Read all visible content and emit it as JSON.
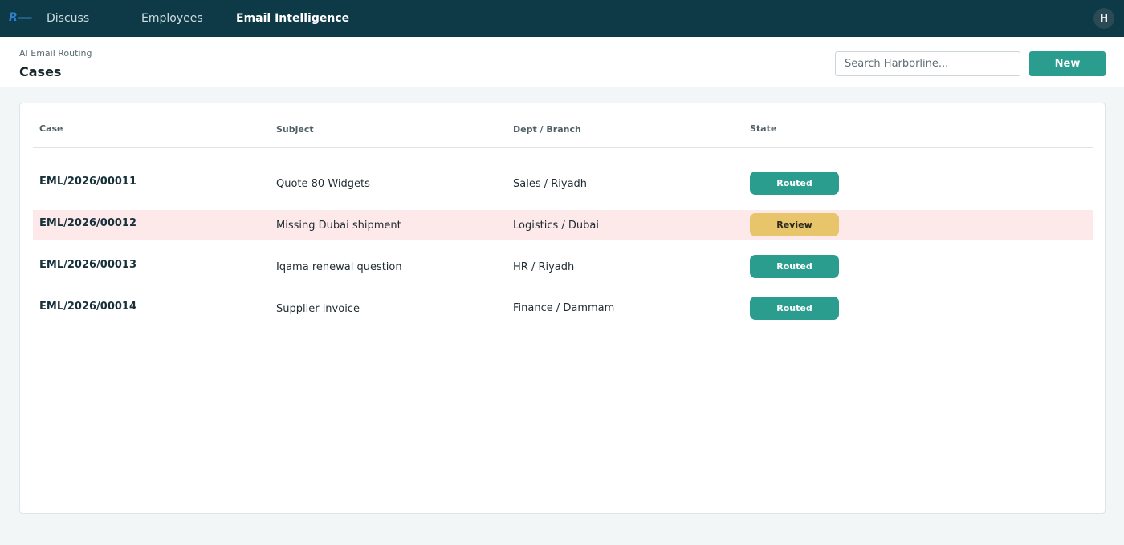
{
  "topbar": {
    "nav": [
      "Discuss",
      "Employees",
      "Email Intelligence"
    ],
    "active": "Email Intelligence",
    "avatar_initial": "H",
    "logo_icon": "harborline-logo-icon"
  },
  "header": {
    "breadcrumb": "AI Email Routing",
    "title": "Cases",
    "search_placeholder": "Search Harborline...",
    "new_label": "New"
  },
  "table": {
    "columns": [
      "Case",
      "Subject",
      "Dept / Branch",
      "State"
    ],
    "rows": [
      {
        "case": "EML/2026/00011",
        "subject": "Quote 80 Widgets",
        "dept": "Sales / Riyadh",
        "state": "Routed"
      },
      {
        "case": "EML/2026/00012",
        "subject": "Missing Dubai shipment",
        "dept": "Logistics / Dubai",
        "state": "Review"
      },
      {
        "case": "EML/2026/00013",
        "subject": "Iqama renewal question",
        "dept": "HR / Riyadh",
        "state": "Routed"
      },
      {
        "case": "EML/2026/00014",
        "subject": "Supplier invoice",
        "dept": "Finance / Dammam",
        "state": "Routed"
      }
    ]
  },
  "colors": {
    "topbar": "#0e3947",
    "accent": "#2a9d8f",
    "review": "#e8c46a",
    "highlight_row": "#fde8ea"
  }
}
